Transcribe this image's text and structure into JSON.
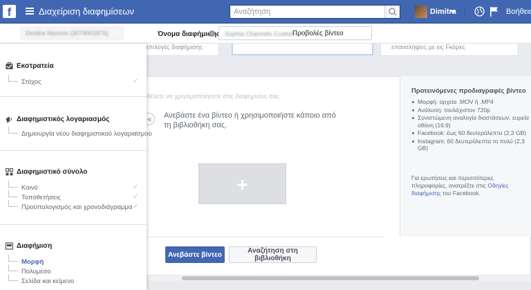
{
  "topbar": {
    "logo": "f",
    "title": "Διαχείριση διαφημίσεων",
    "search_placeholder": "Αναζήτηση",
    "username": "Dimitra",
    "help": "Βοήθεια"
  },
  "accountbar": {
    "account_name": "Dimitra Νουτσα (3079001876)",
    "ad_name_label": "Όνομα διαφήμισης",
    "ad_name_prefix": "Sophia Channels Custom",
    "ad_name_value": "Προβολές βίντεο"
  },
  "sidebar": {
    "sections": [
      {
        "title": "Εκστρατεία",
        "icon": "briefcase-icon",
        "items": [
          {
            "label": "Στόχος",
            "checked": true,
            "active": false
          }
        ]
      },
      {
        "title": "Διαφημιστικός λογαριασμός",
        "icon": "megaphone-icon",
        "items": [
          {
            "label": "Δημιουργία νέου διαφημιστικού λογαριασμού",
            "checked": true,
            "active": false
          }
        ]
      },
      {
        "title": "Διαφημιστικό σύνολο",
        "icon": "grid-icon",
        "items": [
          {
            "label": "Κοινό",
            "checked": true,
            "active": false
          },
          {
            "label": "Τοποθετήσεις",
            "checked": true,
            "active": false
          },
          {
            "label": "Προϋπολογισμός και χρονοδιάγραμμα",
            "checked": true,
            "active": false
          }
        ]
      },
      {
        "title": "Διαφήμιση",
        "icon": "ad-icon",
        "items": [
          {
            "label": "Μορφή",
            "checked": false,
            "active": true
          },
          {
            "label": "Πολυμέσο",
            "checked": false,
            "active": false
          },
          {
            "label": "Σελίδα και κείμενο",
            "checked": false,
            "active": false
          }
        ]
      }
    ]
  },
  "main": {
    "top_card_text_1": "επιλογές διαφήμισης",
    "top_card_text_2": "επαναλήψεις με εις Fκόρες",
    "faded_text": "ου θέλετε να χρησιμοποιήσετε στις διαφημίσεις σας",
    "upload_hint": "Ανεβάστε ένα βίντεο ή χρησιμοποιήστε κάποιο από τη βιβλιοθήκη σας.",
    "upload_button": "Ανεβάστε βίντεο",
    "library_button": "Αναζήτηση στη βιβλιοθήκη"
  },
  "specs": {
    "title": "Προτεινόμενες προδιαγραφές βίντεο",
    "items": [
      "Μορφή: αρχεία .MOV ή .MP4",
      "Ανάλυση: τουλάχιστον 720p",
      "Συνιστώμενη αναλογία διαστάσεων: ευρεία οθόνη (16:9)",
      "Facebook: έως 60 δευτερόλεπτα (2,3 GB)",
      "Instagram: 60 δευτερόλεπτα το πολύ (2,3 GB)"
    ],
    "footer_text": "Για ερωτήσεις και περισσότερες πληροφορίες, ανατρέξτε στις",
    "footer_link": "Οδηγίες διαφήμισης",
    "footer_end": "του Facebook."
  }
}
